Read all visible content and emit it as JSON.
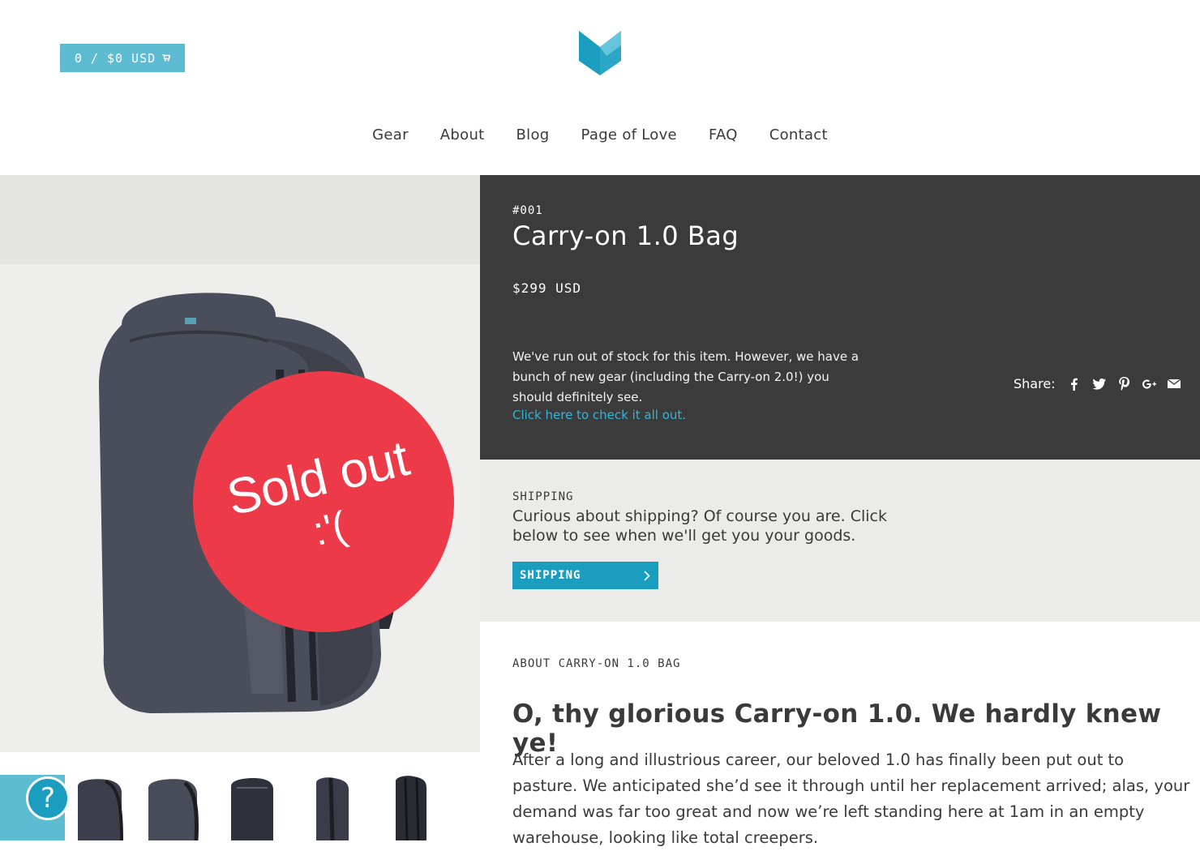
{
  "header": {
    "cart_label": "0 / $0 USD",
    "logo_name": "minaal-logo"
  },
  "nav": {
    "items": [
      {
        "label": "Gear"
      },
      {
        "label": "About"
      },
      {
        "label": "Blog"
      },
      {
        "label": "Page of Love"
      },
      {
        "label": "FAQ"
      },
      {
        "label": "Contact"
      }
    ]
  },
  "product": {
    "sku": "#001",
    "title": "Carry-on 1.0 Bag",
    "price": "$299 USD",
    "badge_line1": "Sold out",
    "badge_line2": ":'(",
    "stock_note": "We've run out of stock for this item. However, we have a bunch of new gear (including the Carry-on 2.0!) you should definitely see.",
    "stock_link": "Click here to check it all out.",
    "share_label": "Share:",
    "share_icons": [
      "facebook-icon",
      "twitter-icon",
      "pinterest-icon",
      "google-plus-icon",
      "email-icon"
    ]
  },
  "shipping": {
    "heading": "SHIPPING",
    "text": "Curious about shipping? Of course you are. Click below to see when we'll get you your goods.",
    "button_label": "SHIPPING"
  },
  "about": {
    "heading": "ABOUT CARRY-ON 1.0 BAG",
    "title": "O, thy glorious Carry-on 1.0. We hardly knew ye!",
    "body": "After a long and illustrious career, our beloved 1.0 has finally been put out to pasture. We anticipated she’d see it through until her replacement arrived; alas, your demand was far too great and now we’re left standing here at 1am in an empty warehouse, looking like total creepers."
  },
  "help": {
    "label": "?"
  },
  "colors": {
    "accent": "#1a9dbf",
    "cart": "#5dbcd2",
    "badge": "#ec3a48",
    "dark_panel": "#3b3b3b",
    "light_panel": "#ebebea"
  }
}
